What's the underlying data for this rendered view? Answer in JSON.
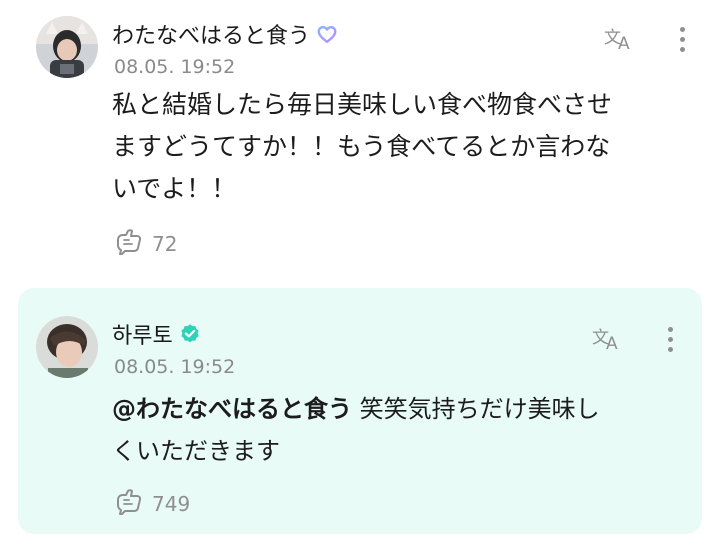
{
  "post": {
    "author": "わたなべはると食う",
    "badge_icon": "heart-outline-badge-icon",
    "timestamp": "08.05. 19:52",
    "text_lines": [
      "私と結婚したら毎日美味しい食べ物食べさせ",
      "ますどうてすか！！もう食べてるとか言わな",
      "いでよ！！"
    ],
    "likes": "72",
    "colors": {
      "badge_gradient_start": "#8ab4ff",
      "badge_gradient_end": "#b98cff"
    }
  },
  "reply": {
    "author": "하루토",
    "badge_icon": "verified-check-icon",
    "timestamp": "08.05. 19:52",
    "mention": "@わたなべはると食う",
    "text_line1_rest": " 笑笑気持ちだけ美味し",
    "text_line2": "くいただきます",
    "likes": "749",
    "colors": {
      "background": "#e8fbf6",
      "verified": "#2ed3b7"
    }
  },
  "icons": {
    "translate": "translate-icon",
    "more": "more-vertical-icon",
    "like": "like-hand-icon"
  }
}
